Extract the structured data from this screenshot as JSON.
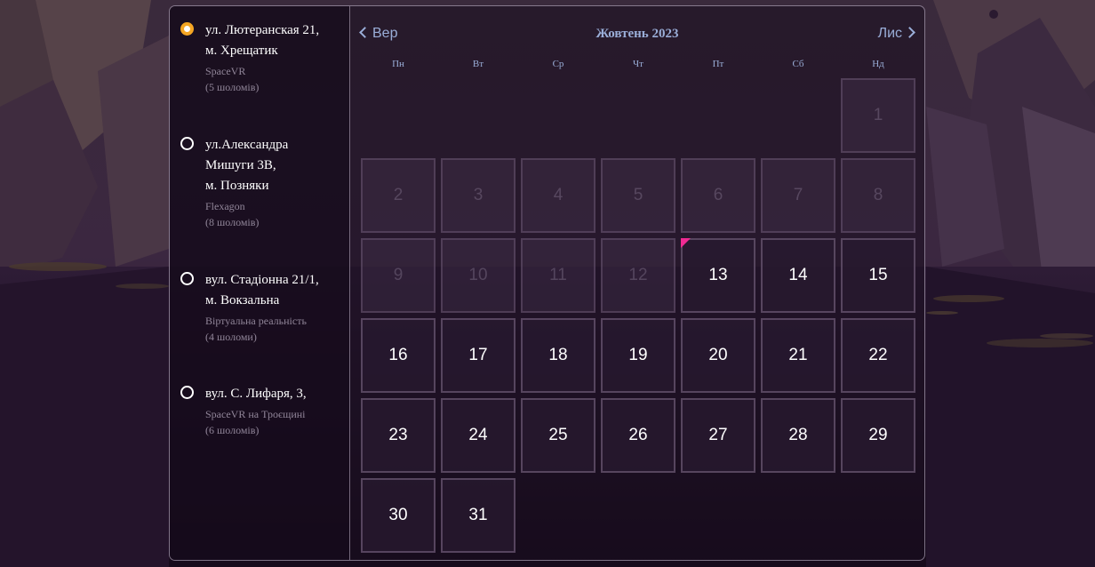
{
  "locations": [
    {
      "address_line1": "ул. Лютеранская 21,",
      "address_line2": "м. Хрещатик",
      "address_line3": "",
      "venue": "SpaceVR",
      "headsets": "(5 шоломів)",
      "selected": true
    },
    {
      "address_line1": "ул.Александра",
      "address_line2": "Мишуги 3В,",
      "address_line3": "м. Позняки",
      "venue": "Flexagon",
      "headsets": "(8 шоломів)",
      "selected": false
    },
    {
      "address_line1": "вул. Стадіонна 21/1,",
      "address_line2": "м. Вокзальна",
      "address_line3": "",
      "venue": "Віртуальна реальність",
      "headsets": "(4 шоломи)",
      "selected": false
    },
    {
      "address_line1": "вул. С. Лифаря, 3,",
      "address_line2": "",
      "address_line3": "",
      "venue": "SpaceVR на Троєщині",
      "headsets": "(6 шоломів)",
      "selected": false
    }
  ],
  "calendar": {
    "prev_label": "Вер",
    "next_label": "Лис",
    "month_title": "Жовтень 2023",
    "weekdays": [
      "Пн",
      "Вт",
      "Ср",
      "Чт",
      "Пт",
      "Сб",
      "Нд"
    ],
    "first_day_column": 7,
    "days_in_month": 31,
    "first_available_day": 13,
    "today": 13
  },
  "colors": {
    "accent_radio": "#f5a623",
    "today_marker": "#f02a93",
    "header_text": "#9aaed8"
  },
  "icons": {
    "prev": "chevron-left-icon",
    "next": "chevron-right-icon"
  }
}
